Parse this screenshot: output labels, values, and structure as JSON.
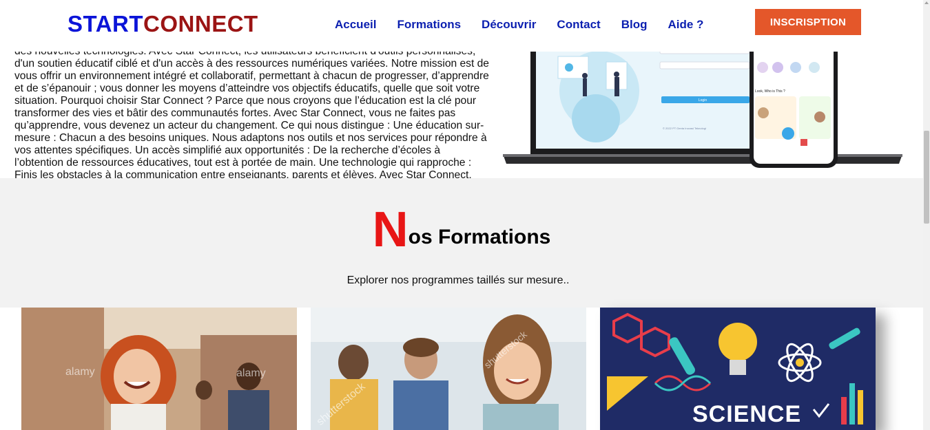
{
  "brand": {
    "part1": "START",
    "part2": "CONNECT"
  },
  "nav": {
    "items": [
      "Accueil",
      "Formations",
      "Découvrir",
      "Contact",
      "Blog",
      "Aide ?"
    ],
    "signup_label": "INSCRISPTION"
  },
  "about": {
    "text": "des nouvelles technologies. Avec Star Connect, les utilisateurs bénéficient d'outils personnalisés, d'un soutien éducatif ciblé et d'un accès à des ressources numériques variées. Notre mission est de vous offrir un environnement intégré et collaboratif, permettant à chacun de progresser, d’apprendre et de s’épanouir ; vous donner les moyens d’atteindre vos objectifs éducatifs, quelle que soit votre situation. Pourquoi choisir Star Connect ? Parce que nous croyons que l’éducation est la clé pour transformer des vies et bâtir des communautés fortes. Avec Star Connect, vous ne faites pas qu’apprendre, vous devenez un acteur du changement. Ce qui nous distingue : Une éducation sur-mesure : Chacun a des besoins uniques. Nous adaptons nos outils et nos services pour répondre à vos attentes spécifiques. Un accès simplifié aux opportunités : De la recherche d’écoles à l’obtention de ressources éducatives, tout est à portée de main. Une technologie qui rapproche : Finis les obstacles à la communication entre enseignants, parents et élèves. Avec Star Connect, chaque clic vous rapproche de vos rêves éducatifs."
  },
  "mockup": {
    "login_button": "Login",
    "look_label": "Look, Who is This ?",
    "footer_note": "© 2022 PT Genta Inovasi Teknologi"
  },
  "formations": {
    "title_initial": "N",
    "title_rest": "os Formations",
    "subtitle": "Explorer nos programmes taillés sur mesure..",
    "cards": [
      {
        "watermark": "alamy"
      },
      {
        "watermark": "shutterstock"
      },
      {
        "label": "SCIENCE"
      }
    ]
  },
  "colors": {
    "brand_blue": "#0b14d8",
    "brand_red": "#9b1414",
    "nav_blue": "#0b1fb0",
    "signup_orange": "#e4572a",
    "title_red": "#e81616",
    "section_bg": "#f2f2f2"
  }
}
